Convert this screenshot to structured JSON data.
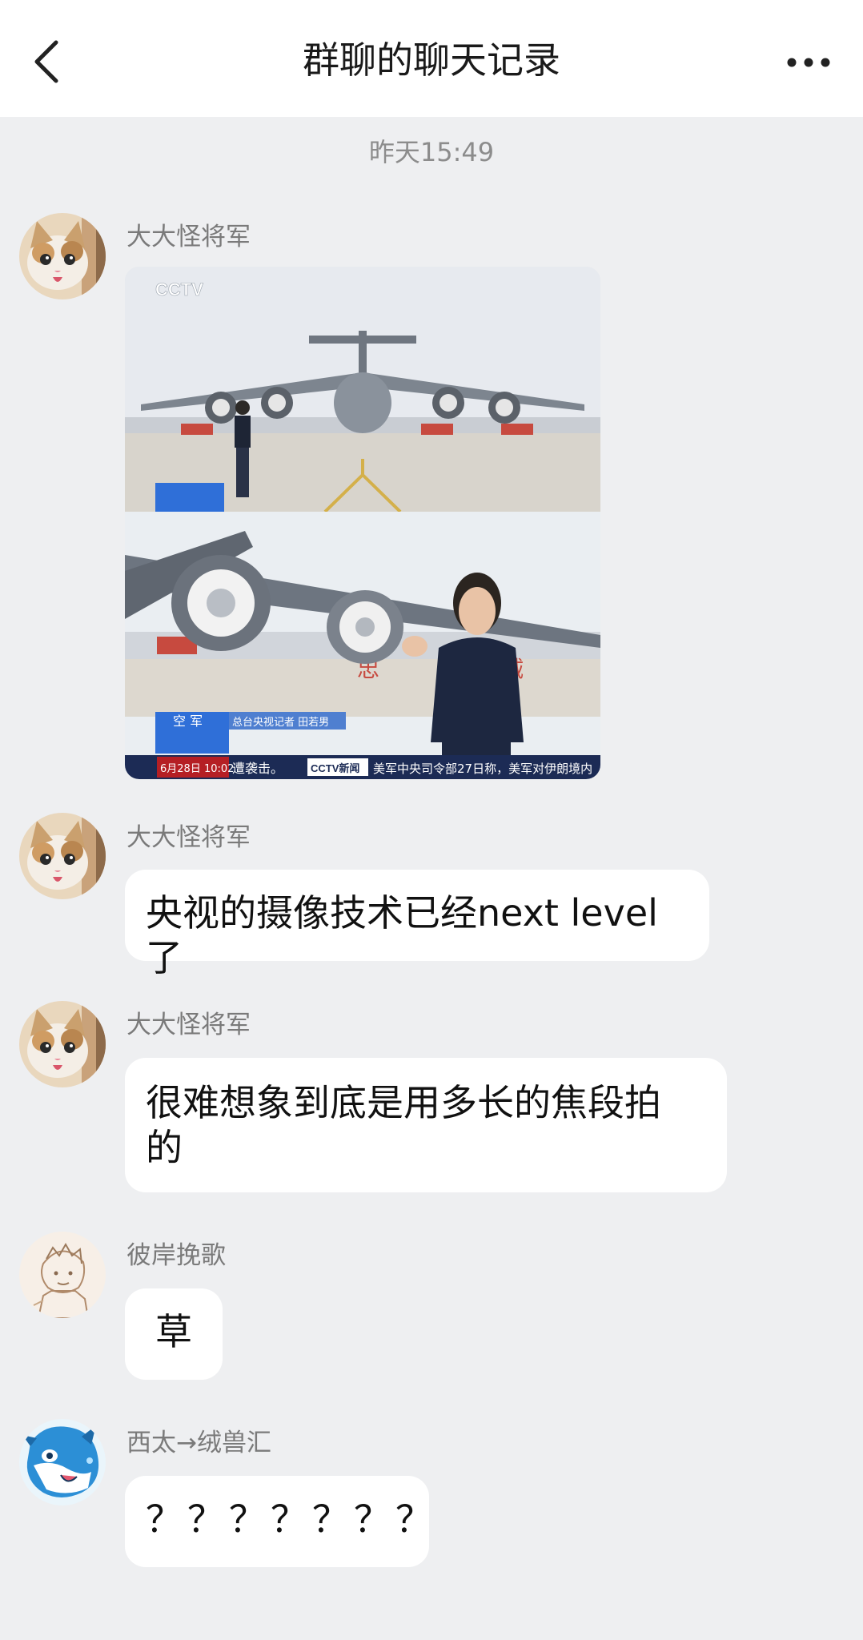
{
  "header": {
    "title": "群聊的聊天记录"
  },
  "timestamp": "昨天15:49",
  "photo_overlay": {
    "channel_top": "CCTV",
    "channel_sub": "新闻",
    "banner_word_left": "忠",
    "banner_word_right": "诚",
    "caption_name": "总台央视记者 田若男",
    "caption_tag": "空 军",
    "ticker_date": "6月28日 10:02",
    "ticker_text_left": "遭袭击。",
    "ticker_brand": "CCTV新闻",
    "ticker_text_right": "美军中央司令部27日称，美军对伊朗境内"
  },
  "messages": [
    {
      "sender": "大大怪将军",
      "type": "image"
    },
    {
      "sender": "大大怪将军",
      "text": "央视的摄像技术已经next level了"
    },
    {
      "sender": "大大怪将军",
      "text_line1": "很难想象到底是用多长的焦段拍",
      "text_line2": "的"
    },
    {
      "sender": "彼岸挽歌",
      "text": "草"
    },
    {
      "sender": "西太→绒兽汇",
      "text": "？？？？？？？"
    }
  ],
  "colors": {
    "background": "#eeeff1",
    "header": "#ffffff",
    "bubble": "#ffffff"
  }
}
